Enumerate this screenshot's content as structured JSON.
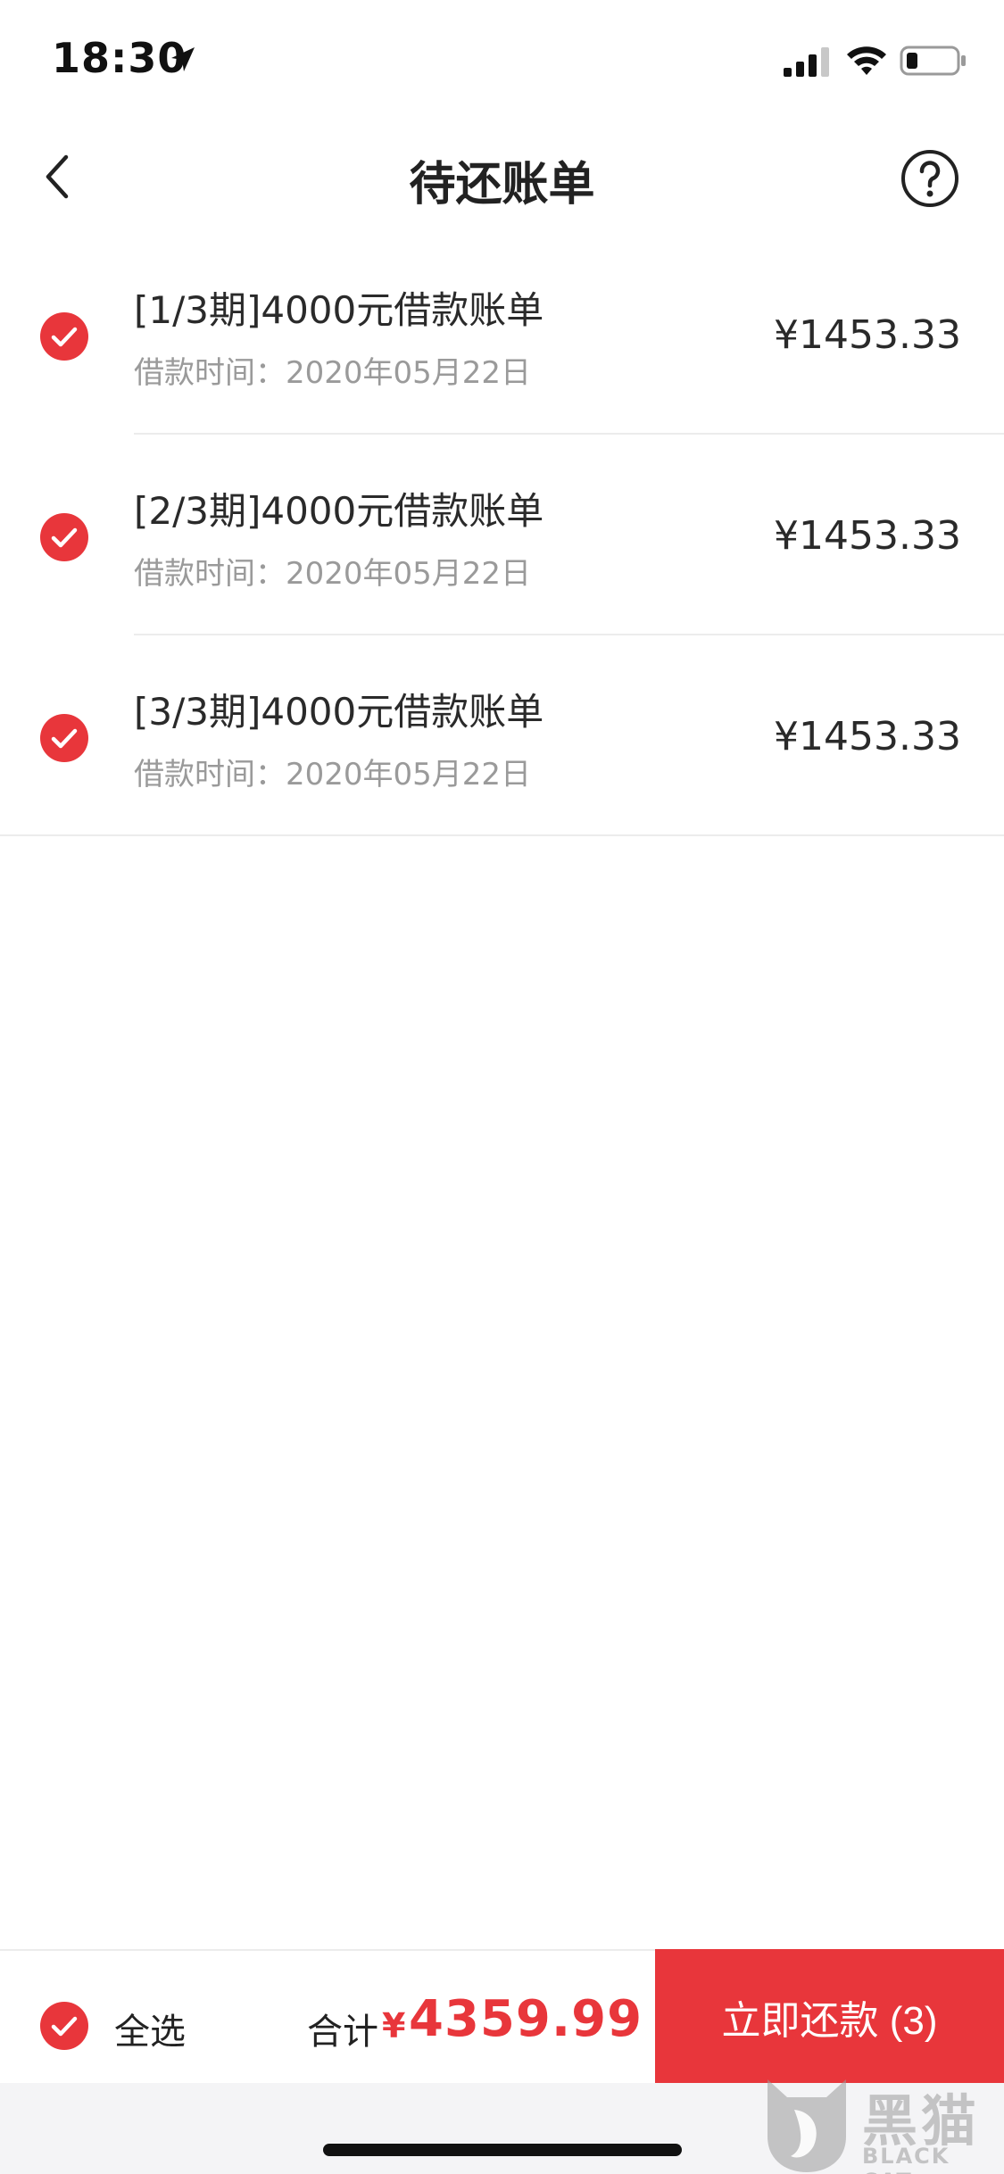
{
  "status_bar": {
    "time": "18:30"
  },
  "nav": {
    "title": "待还账单"
  },
  "bills": [
    {
      "title": "[1/3期]4000元借款账单",
      "date_label": "借款时间：",
      "date": "2020年05月22日",
      "amount": "¥1453.33",
      "checked": true
    },
    {
      "title": "[2/3期]4000元借款账单",
      "date_label": "借款时间：",
      "date": "2020年05月22日",
      "amount": "¥1453.33",
      "checked": true
    },
    {
      "title": "[3/3期]4000元借款账单",
      "date_label": "借款时间：",
      "date": "2020年05月22日",
      "amount": "¥1453.33",
      "checked": true
    }
  ],
  "footer": {
    "select_all_label": "全选",
    "select_all_checked": true,
    "total_label": "合计",
    "currency": "¥",
    "total_value": "4359.99",
    "repay_button_label": "立即还款 (3)"
  },
  "watermark": {
    "text_cn": "黑猫",
    "text_en": "BLACK CAT"
  },
  "colors": {
    "accent": "#e8363b",
    "divider": "#ececec",
    "secondary_text": "#9a9a9a"
  },
  "icons": {
    "location": "location-arrow-icon",
    "signal": "cellular-signal-icon",
    "wifi": "wifi-icon",
    "battery": "battery-icon",
    "back": "chevron-left-icon",
    "help": "help-circle-icon",
    "check": "check-circle-icon"
  }
}
